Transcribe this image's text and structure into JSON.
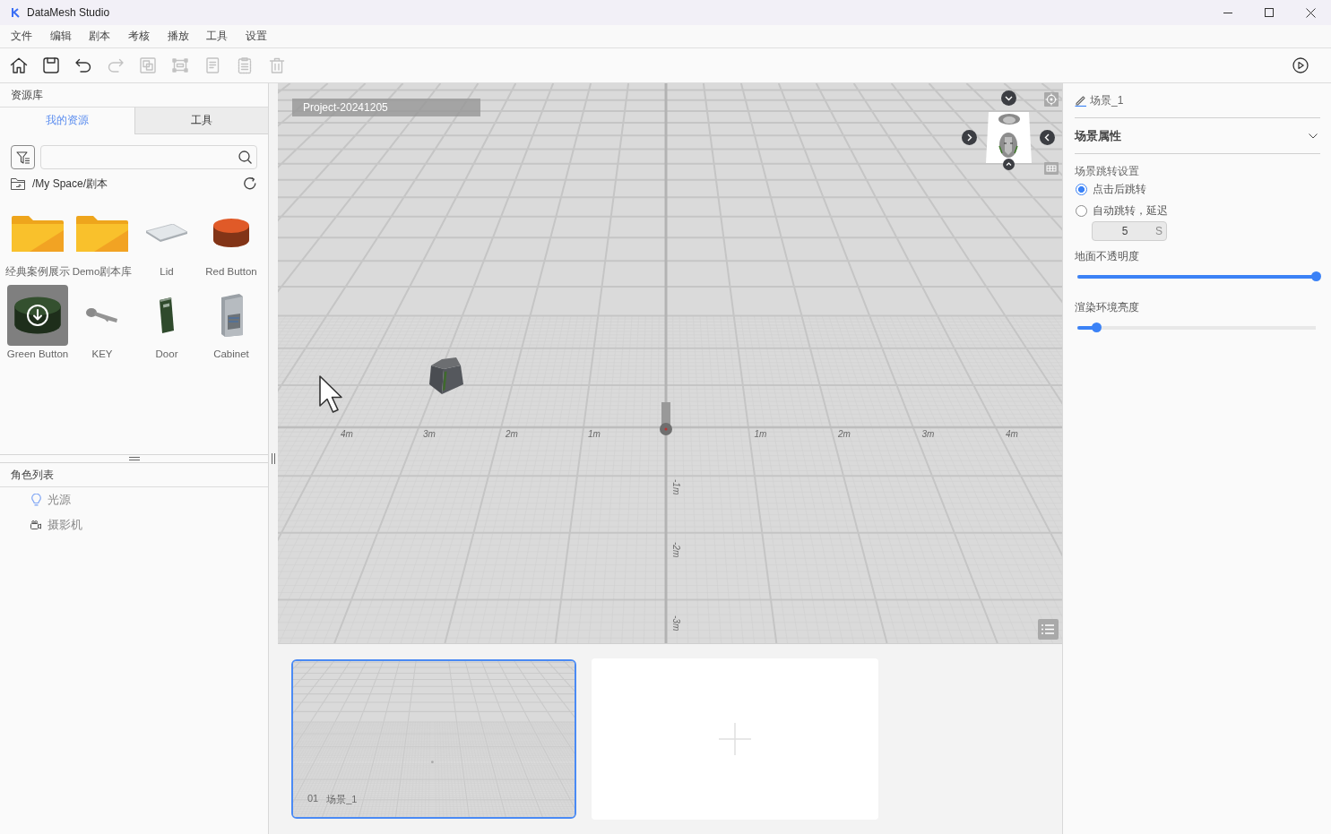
{
  "window": {
    "title": "DataMesh Studio"
  },
  "menu": [
    "文件",
    "编辑",
    "剧本",
    "考核",
    "播放",
    "工具",
    "设置"
  ],
  "toolbar": [
    {
      "kind": "home",
      "disabled": false
    },
    {
      "kind": "save",
      "disabled": false
    },
    {
      "kind": "undo",
      "disabled": false
    },
    {
      "kind": "redo",
      "disabled": true
    },
    {
      "kind": "group",
      "disabled": true
    },
    {
      "kind": "align",
      "disabled": true
    },
    {
      "kind": "copy",
      "disabled": true
    },
    {
      "kind": "paste",
      "disabled": true
    },
    {
      "kind": "delete",
      "disabled": true
    }
  ],
  "library": {
    "title": "资源库",
    "tabs": [
      {
        "label": "我的资源",
        "selected": true
      },
      {
        "label": "工具",
        "selected": false
      }
    ],
    "path": "/My Space/剧本",
    "assets": [
      {
        "name": "经典案例展示",
        "kind": "folder",
        "selected": false
      },
      {
        "name": "Demo剧本库",
        "kind": "folder",
        "selected": false
      },
      {
        "name": "Lid",
        "kind": "plate",
        "selected": false
      },
      {
        "name": "Red Button",
        "kind": "cylinder",
        "color": "#e05a28",
        "selected": false
      },
      {
        "name": "Green Button",
        "kind": "cylinder",
        "color": "#34502f",
        "selected": true
      },
      {
        "name": "KEY",
        "kind": "key",
        "selected": false
      },
      {
        "name": "Door",
        "kind": "door",
        "selected": false
      },
      {
        "name": "Cabinet",
        "kind": "cabinet",
        "selected": false
      }
    ]
  },
  "roles": {
    "title": "角色列表",
    "items": [
      {
        "kind": "light",
        "name": "光源"
      },
      {
        "kind": "camera",
        "name": "摄影机"
      }
    ]
  },
  "viewport": {
    "project": "Project-20241205",
    "x_axis_labels": [
      "4m",
      "3m",
      "2m",
      "1m",
      "1m",
      "2m",
      "3m",
      "4m"
    ],
    "depth_axis_labels": [
      "-1m",
      "-2m",
      "-3m"
    ]
  },
  "scenes": [
    {
      "number": "01",
      "name": "场景_1",
      "selected": true
    }
  ],
  "properties": {
    "scene_name": "场景_1",
    "section": {
      "title": "场景属性",
      "expanded": true
    },
    "jump": {
      "title": "场景跳转设置",
      "options": [
        {
          "label": "点击后跳转",
          "selected": true
        },
        {
          "label": "自动跳转，延迟",
          "selected": false
        }
      ],
      "delay": {
        "value": "5",
        "unit": "S",
        "disabled": true
      }
    },
    "sliders": [
      {
        "label": "地面不透明度",
        "level": 1
      },
      {
        "label": "渲染环境亮度",
        "level": 0.08
      }
    ]
  }
}
